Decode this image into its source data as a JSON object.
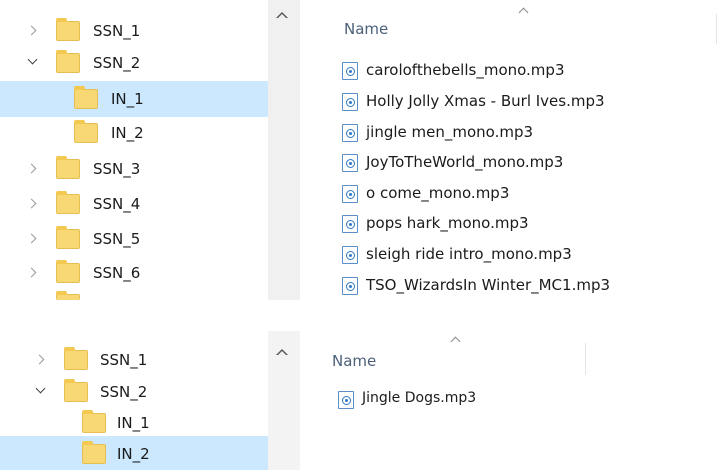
{
  "top": {
    "nav": [
      {
        "label": "SSN_1",
        "expand": "collapsed",
        "selected": false
      },
      {
        "label": "SSN_2",
        "expand": "expanded",
        "selected": false
      },
      {
        "label": "IN_1",
        "expand": "none",
        "selected": true
      },
      {
        "label": "IN_2",
        "expand": "none",
        "selected": false
      },
      {
        "label": "SSN_3",
        "expand": "collapsed",
        "selected": false
      },
      {
        "label": "SSN_4",
        "expand": "collapsed",
        "selected": false
      },
      {
        "label": "SSN_5",
        "expand": "collapsed",
        "selected": false
      },
      {
        "label": "SSN_6",
        "expand": "collapsed",
        "selected": false
      }
    ],
    "column_header": "Name",
    "files": [
      "carolofthebells_mono.mp3",
      "Holly Jolly Xmas - Burl Ives.mp3",
      "jingle men_mono.mp3",
      "JoyToTheWorld_mono.mp3",
      "o come_mono.mp3",
      "pops hark_mono.mp3",
      "sleigh ride intro_mono.mp3",
      "TSO_WizardsIn Winter_MC1.mp3"
    ]
  },
  "bottom": {
    "nav": [
      {
        "label": "SSN_1",
        "expand": "collapsed",
        "selected": false
      },
      {
        "label": "SSN_2",
        "expand": "expanded",
        "selected": false
      },
      {
        "label": "IN_1",
        "expand": "none",
        "selected": false
      },
      {
        "label": "IN_2",
        "expand": "none",
        "selected": true
      }
    ],
    "column_header": "Name",
    "files": [
      "Jingle Dogs.mp3"
    ]
  },
  "colors": {
    "selection": "#cce8ff",
    "folder": "#f8d775",
    "header_text": "#4c607a",
    "file_icon": "#2f78c7"
  },
  "icons": {
    "folder": "folder-icon",
    "audio_file": "audio-file-icon",
    "expand_collapsed": "chevron-right-icon",
    "expand_expanded": "chevron-down-icon",
    "sort": "sort-ascending-icon",
    "scroll_up": "scroll-up-arrow-icon"
  }
}
